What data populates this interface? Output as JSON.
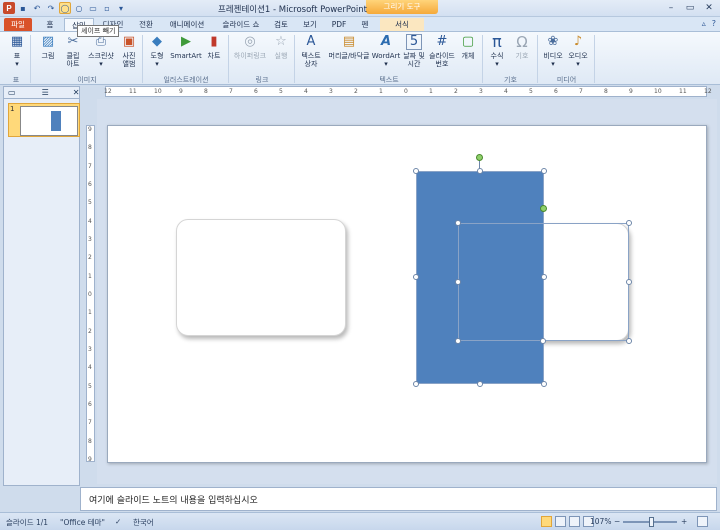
{
  "title_bar": {
    "title": "프레젠테이션1 - Microsoft PowerPoint",
    "context_tab_group": "그리기 도구",
    "qat_icons": [
      "powerpoint-icon",
      "save-icon",
      "undo-icon",
      "redo-icon",
      "shape-icon",
      "circle-icon",
      "folder-icon",
      "print-icon",
      "customize-icon"
    ],
    "window_buttons": [
      "minimize-icon",
      "maximize-icon",
      "close-icon"
    ]
  },
  "tabs": [
    {
      "label": "파일",
      "name": "tab-file"
    },
    {
      "label": "홈",
      "name": "tab-home"
    },
    {
      "label": "삽입",
      "name": "tab-insert"
    },
    {
      "label": "디자인",
      "name": "tab-design"
    },
    {
      "label": "전환",
      "name": "tab-transitions"
    },
    {
      "label": "애니메이션",
      "name": "tab-animations"
    },
    {
      "label": "슬라이드 쇼",
      "name": "tab-slideshow"
    },
    {
      "label": "검토",
      "name": "tab-review"
    },
    {
      "label": "보기",
      "name": "tab-view"
    },
    {
      "label": "PDF",
      "name": "tab-pdf"
    },
    {
      "label": "펜",
      "name": "tab-pen"
    },
    {
      "label": "서식",
      "name": "tab-format"
    }
  ],
  "tooltip": "셰이프 빼기",
  "ribbon": {
    "buttons": [
      {
        "label": "표",
        "label2": "",
        "icon": "table-icon",
        "glyph": "▦",
        "color": "#2b5797"
      },
      {
        "label": "그림",
        "label2": "",
        "icon": "picture-icon",
        "glyph": "🖼",
        "color": "#3a7dbe"
      },
      {
        "label": "클립",
        "label2": "아트",
        "icon": "clipart-icon",
        "glyph": "✂",
        "color": "#4a6c9b"
      },
      {
        "label": "스크린샷",
        "label2": "",
        "icon": "screenshot-icon",
        "glyph": "⎙",
        "color": "#4a6c9b"
      },
      {
        "label": "사진",
        "label2": "앨범",
        "icon": "photo-album-icon",
        "glyph": "▣",
        "color": "#c9542a"
      },
      {
        "label": "도형",
        "label2": "",
        "icon": "shapes-icon",
        "glyph": "◆",
        "color": "#3a7dbe"
      },
      {
        "label": "SmartArt",
        "label2": "",
        "icon": "smartart-icon",
        "glyph": "▶",
        "color": "#3f9a3a"
      },
      {
        "label": "차트",
        "label2": "",
        "icon": "chart-icon",
        "glyph": "▮",
        "color": "#c0392b"
      },
      {
        "label": "하이퍼링크",
        "label2": "",
        "icon": "hyperlink-icon",
        "glyph": "◎",
        "color": "#9aa6b4"
      },
      {
        "label": "실행",
        "label2": "",
        "icon": "action-icon",
        "glyph": "☆",
        "color": "#9aa6b4"
      },
      {
        "label": "텍스트",
        "label2": "상자",
        "icon": "textbox-icon",
        "glyph": "A",
        "color": "#2b5797"
      },
      {
        "label": "머리글/바닥글",
        "label2": "",
        "icon": "header-footer-icon",
        "glyph": "▤",
        "color": "#c98a2a"
      },
      {
        "label": "WordArt",
        "label2": "",
        "icon": "wordart-icon",
        "glyph": "A",
        "color": "#2b6cb0"
      },
      {
        "label": "날짜 및",
        "label2": "시간",
        "icon": "date-time-icon",
        "glyph": "5",
        "color": "#2b5797"
      },
      {
        "label": "슬라이드",
        "label2": "번호",
        "icon": "slide-number-icon",
        "glyph": "#",
        "color": "#2b5797"
      },
      {
        "label": "개체",
        "label2": "",
        "icon": "object-icon",
        "glyph": "▢",
        "color": "#3f9a3a"
      },
      {
        "label": "수식",
        "label2": "",
        "icon": "equation-icon",
        "glyph": "π",
        "color": "#2b5797"
      },
      {
        "label": "기호",
        "label2": "",
        "icon": "symbol-icon",
        "glyph": "Ω",
        "color": "#9aa6b4"
      },
      {
        "label": "비디오",
        "label2": "",
        "icon": "video-icon",
        "glyph": "❀",
        "color": "#4a6c9b"
      },
      {
        "label": "오디오",
        "label2": "",
        "icon": "audio-icon",
        "glyph": "♪",
        "color": "#c98a2a"
      }
    ],
    "groups": [
      "표",
      "이미지",
      "일러스트레이션",
      "링크",
      "텍스트",
      "기호",
      "미디어"
    ]
  },
  "ruler_h": [
    "12",
    "11",
    "10",
    "9",
    "8",
    "7",
    "6",
    "5",
    "4",
    "3",
    "2",
    "1",
    "0",
    "1",
    "2",
    "3",
    "4",
    "5",
    "6",
    "7",
    "8",
    "9",
    "10",
    "11",
    "12"
  ],
  "ruler_v": [
    "9",
    "8",
    "7",
    "6",
    "5",
    "4",
    "3",
    "2",
    "1",
    "0",
    "1",
    "2",
    "3",
    "4",
    "5",
    "6",
    "7",
    "8",
    "9"
  ],
  "pane": {
    "slide_number": "1",
    "tab_icons": [
      "slides-tab-icon",
      "outline-tab-icon",
      "close-icon"
    ]
  },
  "notes_placeholder": "여기에 슬라이드 노트의 내용을 입력하십시오",
  "status": {
    "slide": "슬라이드 1/1",
    "theme": "\"Office 테마\"",
    "language": "한국어",
    "zoom": "107%"
  },
  "colors": {
    "shape_fill": "#4f81bd",
    "file_tab": "#d9522a"
  }
}
